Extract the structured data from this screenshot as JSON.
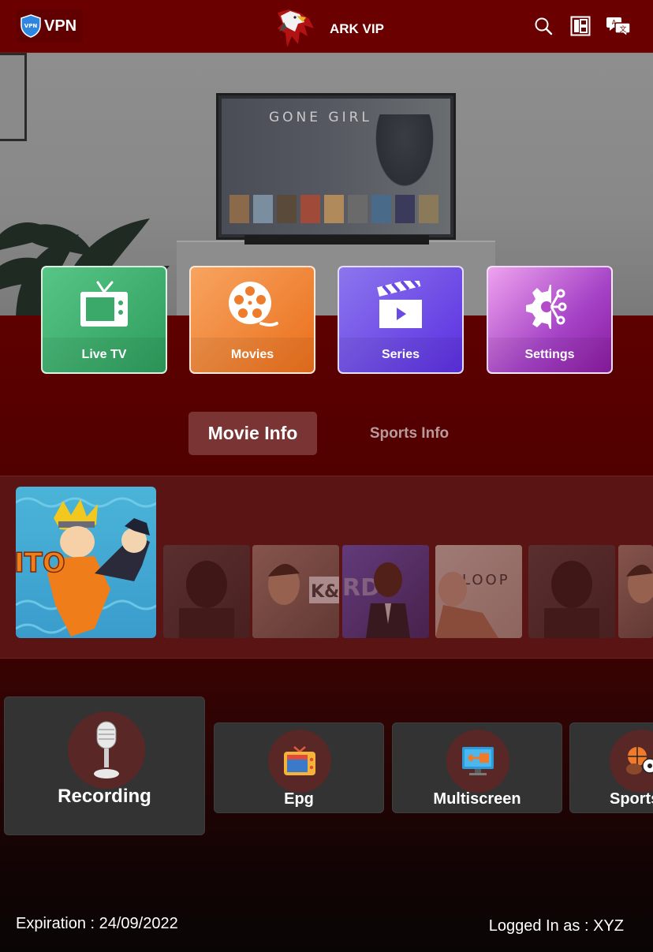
{
  "header": {
    "vpn_label": "VPN",
    "vpn_badge": "VPN",
    "brand": "ARK VIP",
    "icons": [
      "search-icon",
      "layout-grid-icon",
      "translate-icon"
    ]
  },
  "hero": {
    "tv_title": "GONE GIRL"
  },
  "tiles": [
    {
      "label": "Live TV",
      "icon": "tv-icon",
      "color": "#3aa96a"
    },
    {
      "label": "Movies",
      "icon": "film-reel-icon",
      "color": "#f08a3a"
    },
    {
      "label": "Series",
      "icon": "clapperboard-icon",
      "color": "#6a4ae6"
    },
    {
      "label": "Settings",
      "icon": "gear-network-icon",
      "color": "#b24cc8"
    }
  ],
  "tabs": {
    "active": "Movie Info",
    "inactive": "Sports Info"
  },
  "posters": {
    "featured_caption": "ITO",
    "titles": [
      "KEY AND PEELE",
      "LOOPER"
    ]
  },
  "cards": [
    {
      "label": "Recording",
      "icon": "microphone-icon"
    },
    {
      "label": "Epg",
      "icon": "tv-guide-icon"
    },
    {
      "label": "Multiscreen",
      "icon": "monitor-icon"
    },
    {
      "label": "Sports",
      "icon": "sports-balls-icon"
    }
  ],
  "footer": {
    "expiration": "Expiration : 24/09/2022",
    "logged_in": "Logged In as : XYZ"
  }
}
